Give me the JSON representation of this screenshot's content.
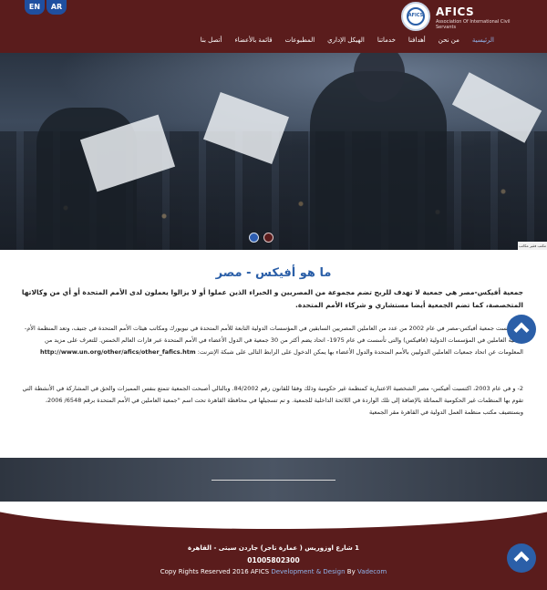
{
  "header": {
    "lang": {
      "en": "EN",
      "ar": "AR"
    },
    "logo": {
      "title": "AFICS",
      "subtitle": "Association Of International Civil Servants",
      "emblem": "AFICS"
    },
    "nav": [
      {
        "label": "الرئيسية",
        "active": true
      },
      {
        "label": "من نحن"
      },
      {
        "label": "أهدافنا"
      },
      {
        "label": "خدماتنا"
      },
      {
        "label": "الهيكل الإداري"
      },
      {
        "label": "المطبوعات"
      },
      {
        "label": "قائمة بالأعضاء"
      },
      {
        "label": "أتصل بنا"
      }
    ]
  },
  "hero": {
    "credit": "مكتب فقير مكاتب"
  },
  "content": {
    "title": "ما هو أفيكس - مصر",
    "lead": "جمعية أفيكس-مصر هي جمعية لا تهدف للربح تضم مجموعة من المصريين و الخبراء الذين عملوا أو لا يزالوا يعملون لدى الأمم المتحدة أو أي من وكالاتها المتخصصة، كما تضم الجمعية أيضا مستشاري و شركاء الأمم المتحدة.",
    "para1": "1- تأسست جمعية أفيكس-مصر في عام 2002 من عدد من العاملين المصريين السابقين في المؤسسات الدولية التابعة للأمم المتحدة في نيويورك ومكاتب هيئات الأمم المتحدة في جنيف، وتعد المنظمة الأم- جمعية العاملين في المؤسسات الدولية (فافيكس) والتى تأسست في عام 1975- اتحاد يضم أكثر من 30 جمعية في الدول الأعضاء في الأمم المتحدة عبر قارات العالم الخمس. للتعرف على مزيد من المعلومات عن اتحاد جمعيات العاملين الدوليين بالأمم المتحدة والدول الأعضاء بها يمكن الدخول على الرابط التالى على شبكة الإنترنت:",
    "para1_url": "http://www.un.org/other/afics/other_fafics.htm",
    "para2": "2- و في عام 2003، اكتسبت أفيكس- مصر الشخصية الاعتبارية كمنظمة غير حكومية وذلك وفقا للقانون رقم 84/2002. وبالتالي أصبحت الجمعية تتمتع بنفس المميزات والحق في المشاركة في الأنشطة التي تقوم بها المنظمات غير الحكومية المماثلة بالإضافة إلى تلك الواردة في اللائحة الداخلية للجمعية. و تم تسجيلها في محافظة القاهرة تحت اسم \"جمعية العاملين في الأمم المتحدة برقم 6548/ 2006، وبستضيف مكتب منظمة العمل الدولية في القاهرة مقر الجمعية"
  },
  "footer": {
    "address": "1 شارع اوزوريس ( عمارة تاجر) جاردن سيتى - القاهرة",
    "phone": "01005802300",
    "copy_prefix": "Copy Rights Reserved 2016 AFICS",
    "copy_mid": "Development & Design",
    "copy_by": "By",
    "copy_vendor": "Vadecom"
  },
  "colors": {
    "brand": "#5a1c1c",
    "accent": "#2b5fa8",
    "nav_active": "#8fb3ea"
  },
  "icons": {
    "scroll_top": "chevron-up-icon"
  }
}
